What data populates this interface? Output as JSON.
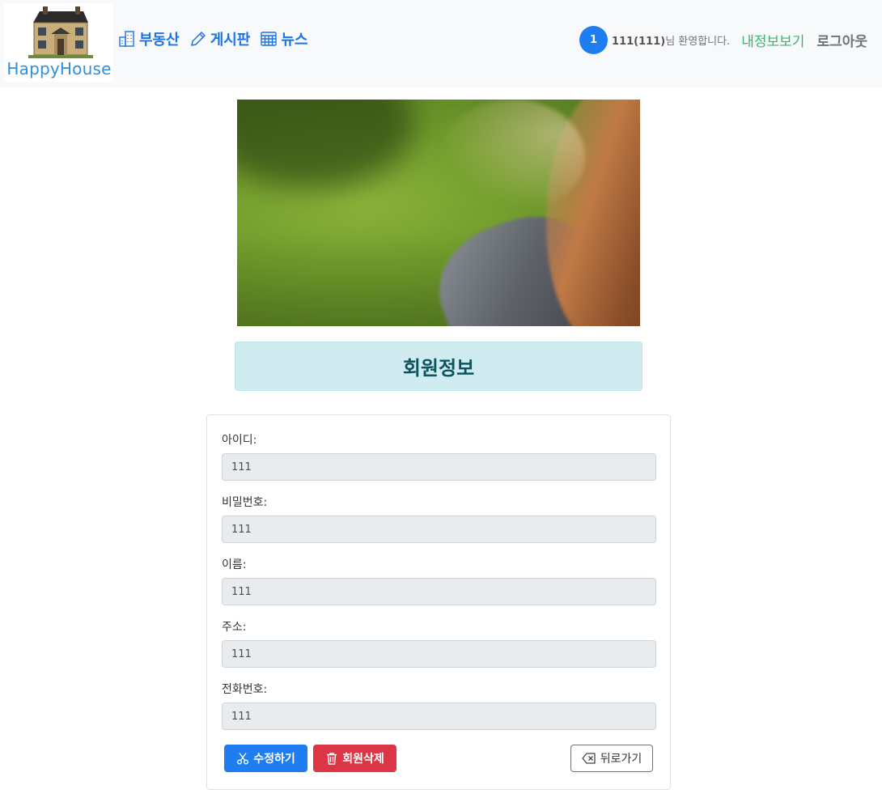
{
  "header": {
    "logo_text": "HappyHouse",
    "nav": [
      {
        "label": "부동산",
        "icon": "buildings-icon"
      },
      {
        "label": "게시판",
        "icon": "pencil-icon"
      },
      {
        "label": "뉴스",
        "icon": "calendar-grid-icon"
      }
    ],
    "badge": "1",
    "welcome_user": "111(111)",
    "welcome_suffix": "님 환영합니다.",
    "my_info": "내정보보기",
    "logout": "로그아웃"
  },
  "page": {
    "title": "회원정보"
  },
  "form": {
    "fields": [
      {
        "label": "아이디:",
        "value": "111"
      },
      {
        "label": "비밀번호:",
        "value": "111"
      },
      {
        "label": "이름:",
        "value": "111"
      },
      {
        "label": "주소:",
        "value": "111"
      },
      {
        "label": "전화번호:",
        "value": "111"
      }
    ],
    "buttons": {
      "edit": "수정하기",
      "delete": "회원삭제",
      "back": "뒤로가기"
    }
  },
  "colors": {
    "accent": "#1e7ef1",
    "danger": "#dc3545",
    "success": "#3cb371",
    "info_bg": "#d1ecf1",
    "info_text": "#0c5460"
  }
}
